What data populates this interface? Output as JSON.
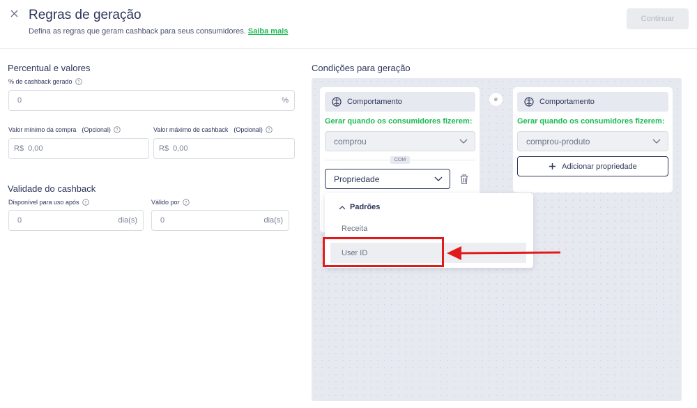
{
  "header": {
    "title": "Regras de geração",
    "subtitle": "Defina as regras que geram cashback para seus consumidores.",
    "saiba_mais": "Saiba mais",
    "continue_label": "Continuar"
  },
  "percentual": {
    "section_title": "Percentual e valores",
    "cashback_label": "% de cashback gerado",
    "cashback_value": "0",
    "cashback_suffix": "%",
    "min_purchase_label": "Valor mínimo da compra",
    "optional": "(Opcional)",
    "max_cashback_label": "Valor máximo de cashback",
    "currency_prefix": "R$",
    "min_purchase_placeholder": "0,00",
    "max_cashback_placeholder": "0,00"
  },
  "validade": {
    "section_title": "Validade do cashback",
    "available_after_label": "Disponível para uso após",
    "valid_for_label": "Válido por",
    "available_after_value": "0",
    "valid_for_value": "0",
    "unit": "dia(s)"
  },
  "conditions": {
    "section_title": "Condições para geração",
    "connector": "e",
    "card1": {
      "header": "Comportamento",
      "prompt": "Gerar quando os consumidores fizerem:",
      "action_value": "comprou",
      "com_label": "COM",
      "property_value": "Propriedade"
    },
    "card2": {
      "header": "Comportamento",
      "prompt": "Gerar quando os consumidores fizerem:",
      "action_value": "comprou-produto",
      "add_property_label": "Adicionar propriedade"
    },
    "dropdown": {
      "group_label": "Padrões",
      "items": [
        "Receita",
        "User ID"
      ]
    }
  },
  "colors": {
    "accent_green": "#1db954",
    "navy": "#2c3559",
    "annotation_red": "#e01b1b"
  }
}
